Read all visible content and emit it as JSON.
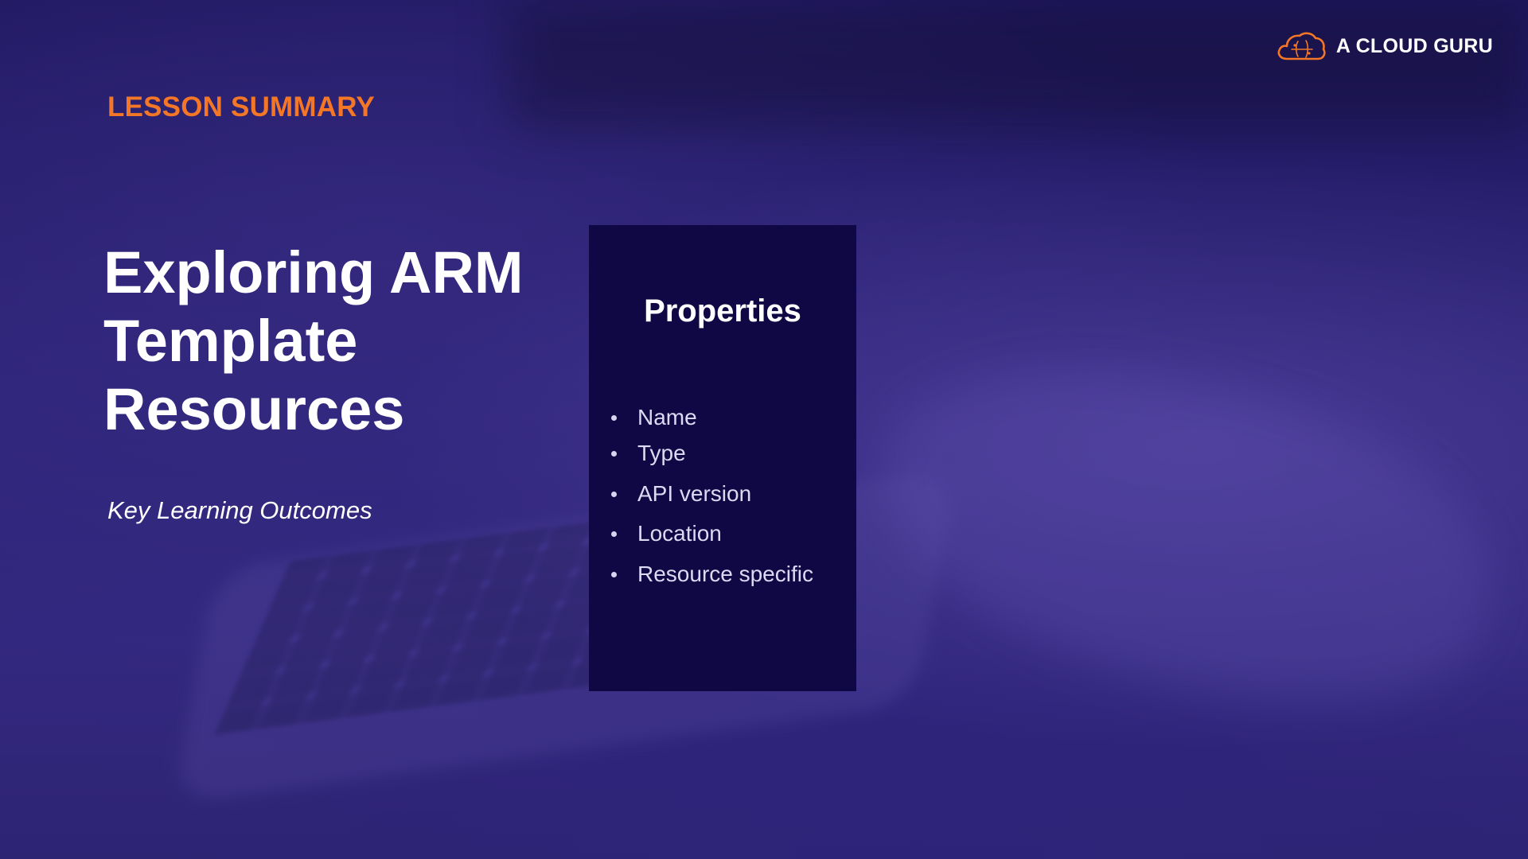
{
  "slide": {
    "eyebrow": "LESSON SUMMARY",
    "title_lines": [
      "Exploring ARM",
      "Template",
      "Resources"
    ],
    "subtitle": "Key Learning Outcomes"
  },
  "brand": {
    "name": "A CLOUD GURU",
    "logo_icon": "cloud-icon"
  },
  "card": {
    "title": "Properties",
    "items": [
      "Name",
      "Type",
      "API version",
      "Location",
      "Resource specific"
    ]
  },
  "colors": {
    "accent": "#f37727",
    "background": "#2c2373",
    "card_background": "#0f0844",
    "text": "#ffffff"
  }
}
